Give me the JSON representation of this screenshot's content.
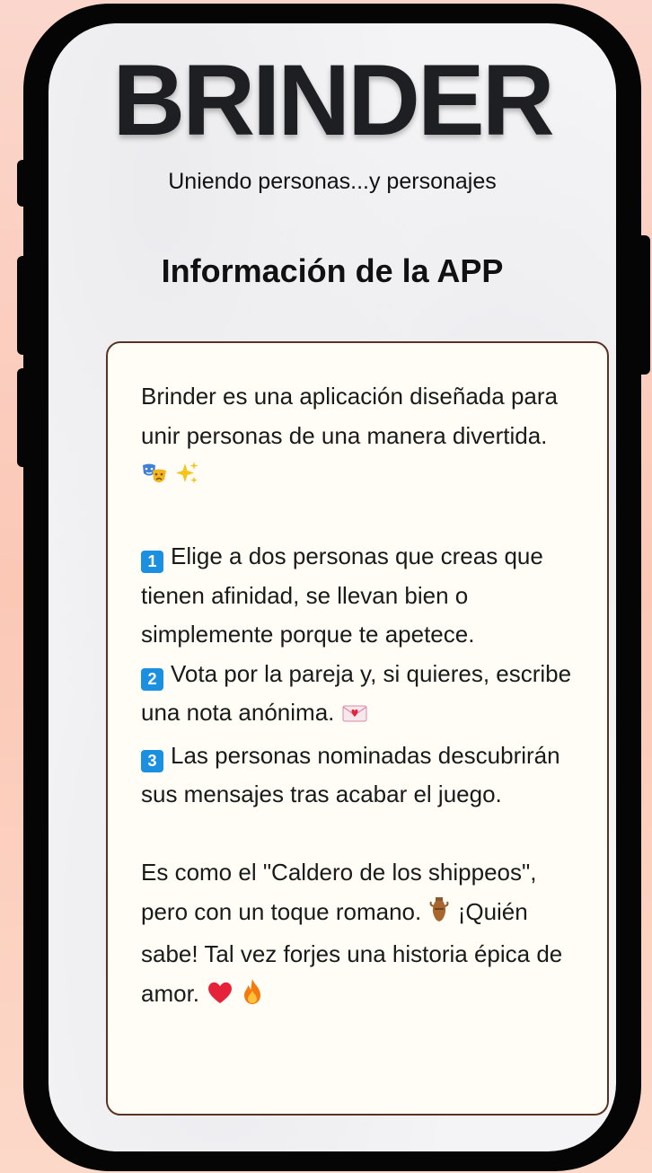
{
  "app": {
    "title": "BRINDER",
    "subtitle": "Uniendo personas...y personajes",
    "section_title": "Información de la APP"
  },
  "info": {
    "intro": "Brinder es una aplicación diseñada para unir personas de una manera divertida.",
    "step1_number": "1",
    "step1_text": "Elige a dos personas que creas que tienen afinidad, se llevan bien o simplemente porque te apetece.",
    "step2_number": "2",
    "step2_text": "Vota por la pareja y, si quieres, escribe una nota anónima.",
    "step3_number": "3",
    "step3_text": "Las personas nominadas descubrirán sus mensajes tras acabar el juego.",
    "outro_part1": "Es como el \"Caldero de los shippeos\", pero con un toque romano.",
    "outro_part2": "¡Quién sabe! Tal vez forjes una historia épica de amor."
  },
  "icons": {
    "intro_icons": [
      "theater-masks-icon",
      "sparkles-icon"
    ],
    "step2_icon": "love-letter-icon",
    "outro_icons": [
      "amphora-icon",
      "red-heart-icon",
      "fire-icon"
    ]
  },
  "colors": {
    "card_background": "#fffdf6",
    "card_border": "#5a3322",
    "number_badge": "#1b8fe0",
    "heart": "#e5223a",
    "fire": "#f4790f"
  }
}
